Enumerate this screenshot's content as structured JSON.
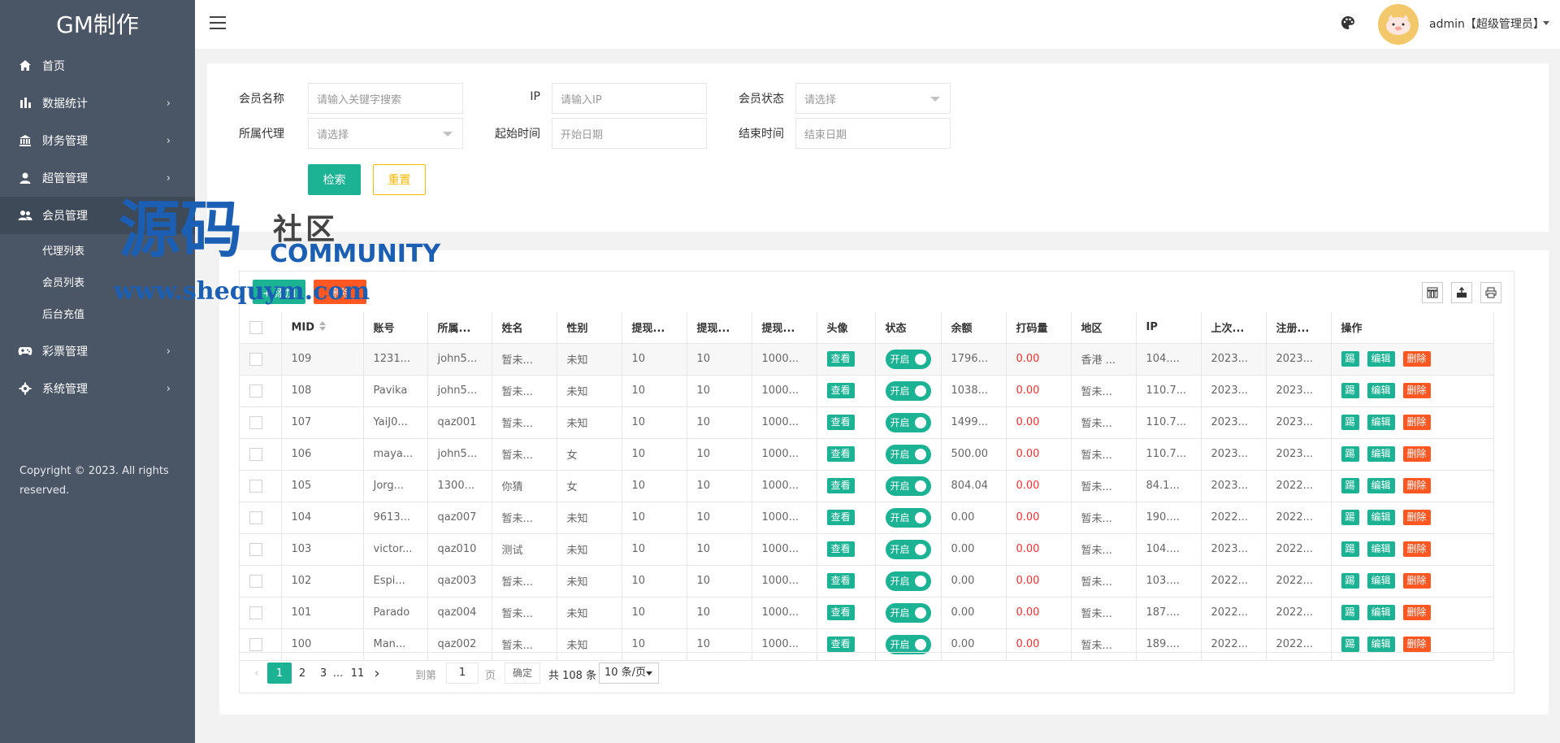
{
  "brand": {
    "title": "GM制作"
  },
  "sidebar": {
    "items": [
      {
        "label": "首页",
        "icon": "home-icon",
        "has_children": false
      },
      {
        "label": "数据统计",
        "icon": "bar-chart-icon",
        "has_children": true
      },
      {
        "label": "财务管理",
        "icon": "bank-icon",
        "has_children": true
      },
      {
        "label": "超管管理",
        "icon": "user-icon",
        "has_children": true
      },
      {
        "label": "会员管理",
        "icon": "users-icon",
        "has_children": true,
        "active": true
      },
      {
        "label": "彩票管理",
        "icon": "gamepad-icon",
        "has_children": true
      },
      {
        "label": "系统管理",
        "icon": "gear-icon",
        "has_children": true
      }
    ],
    "sub_items": [
      "代理列表",
      "会员列表",
      "后台充值"
    ],
    "copyright": "Copyright © 2023. All rights reserved."
  },
  "header": {
    "user": "admin【超级管理员】"
  },
  "search": {
    "fields": [
      {
        "label": "会员名称",
        "placeholder": "请输入关键字搜索",
        "type": "input"
      },
      {
        "label": "IP",
        "placeholder": "请输入IP",
        "type": "input"
      },
      {
        "label": "会员状态",
        "placeholder": "请选择",
        "type": "select"
      },
      {
        "label": "所属代理",
        "placeholder": "请选择",
        "type": "select"
      },
      {
        "label": "起始时间",
        "placeholder": "开始日期",
        "type": "input"
      },
      {
        "label": "结束时间",
        "placeholder": "结束日期",
        "type": "input"
      }
    ],
    "search_label": "检索",
    "reset_label": "重置"
  },
  "toolbar": {
    "add_label": "+ 添加",
    "delete_label": "删除"
  },
  "table": {
    "columns": [
      "MID",
      "账号",
      "所属...",
      "姓名",
      "性别",
      "提现...",
      "提现...",
      "提现...",
      "头像",
      "状态",
      "余额",
      "打码量",
      "地区",
      "IP",
      "上次...",
      "注册...",
      "操作"
    ],
    "view_label": "查看",
    "switch_label": "开启",
    "op_labels": [
      "踢",
      "编辑",
      "删除"
    ],
    "rows": [
      [
        "109",
        "1231...",
        "john5...",
        "暂未...",
        "未知",
        "10",
        "10",
        "1000...",
        "1796...",
        "0.00",
        "香港 ...",
        "104....",
        "2023...",
        "2023..."
      ],
      [
        "108",
        "Pavika",
        "john5...",
        "暂未...",
        "未知",
        "10",
        "10",
        "1000...",
        "1038...",
        "0.00",
        "暂未...",
        "110.7...",
        "2023...",
        "2023..."
      ],
      [
        "107",
        "YaiJ0...",
        "qaz001",
        "暂未...",
        "未知",
        "10",
        "10",
        "1000...",
        "1499...",
        "0.00",
        "暂未...",
        "110.7...",
        "2023...",
        "2023..."
      ],
      [
        "106",
        "maya...",
        "john5...",
        "暂未...",
        "女",
        "10",
        "10",
        "1000...",
        "500.00",
        "0.00",
        "暂未...",
        "110.7...",
        "2023...",
        "2023..."
      ],
      [
        "105",
        "Jorg...",
        "1300...",
        "你猜",
        "女",
        "10",
        "10",
        "1000...",
        "804.04",
        "0.00",
        "暂未...",
        "84.1...",
        "2023...",
        "2022..."
      ],
      [
        "104",
        "9613...",
        "qaz007",
        "暂未...",
        "未知",
        "10",
        "10",
        "1000...",
        "0.00",
        "0.00",
        "暂未...",
        "190....",
        "2022...",
        "2022..."
      ],
      [
        "103",
        "victor...",
        "qaz010",
        "测试",
        "未知",
        "10",
        "10",
        "1000...",
        "0.00",
        "0.00",
        "暂未...",
        "104....",
        "2023...",
        "2022..."
      ],
      [
        "102",
        "Espi...",
        "qaz003",
        "暂未...",
        "未知",
        "10",
        "10",
        "1000...",
        "0.00",
        "0.00",
        "暂未...",
        "103....",
        "2022...",
        "2022..."
      ],
      [
        "101",
        "Parado",
        "qaz004",
        "暂未...",
        "未知",
        "10",
        "10",
        "1000...",
        "0.00",
        "0.00",
        "暂未...",
        "187....",
        "2022...",
        "2022..."
      ],
      [
        "100",
        "Man...",
        "qaz002",
        "暂未...",
        "未知",
        "10",
        "10",
        "1000...",
        "0.00",
        "0.00",
        "暂未...",
        "189....",
        "2022...",
        "2022..."
      ]
    ]
  },
  "pagination": {
    "pages": [
      "1",
      "2",
      "3",
      "...",
      "11"
    ],
    "current": "1",
    "goto_label": "到第",
    "goto_value": "1",
    "page_unit": "页",
    "confirm_label": "确定",
    "total": "共 108 条",
    "page_size": "10 条/页"
  },
  "watermark": {
    "text_cn": "源码",
    "text_cn2": "社区",
    "text_en": "COMMUNITY",
    "url": "www.shequym.com"
  }
}
